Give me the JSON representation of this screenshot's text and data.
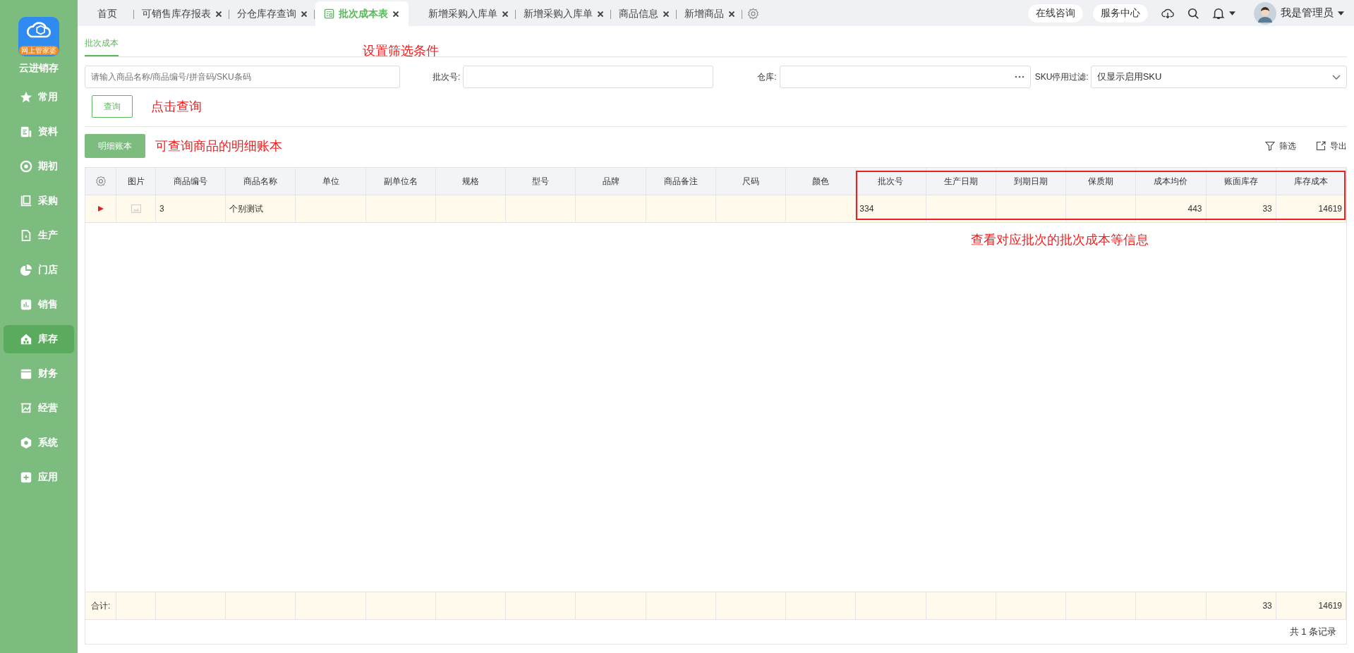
{
  "sidebar": {
    "logo_badge": "网上管家婆",
    "app_name": "云进销存",
    "items": [
      {
        "label": "常用",
        "selected": false
      },
      {
        "label": "资料",
        "selected": false
      },
      {
        "label": "期初",
        "selected": false
      },
      {
        "label": "采购",
        "selected": false
      },
      {
        "label": "生产",
        "selected": false
      },
      {
        "label": "门店",
        "selected": false
      },
      {
        "label": "销售",
        "selected": false
      },
      {
        "label": "库存",
        "selected": true
      },
      {
        "label": "财务",
        "selected": false
      },
      {
        "label": "经营",
        "selected": false
      },
      {
        "label": "系统",
        "selected": false
      },
      {
        "label": "应用",
        "selected": false
      }
    ]
  },
  "tabs": [
    {
      "label": "首页",
      "selected": false,
      "closable": false
    },
    {
      "label": "可销售库存报表",
      "selected": false,
      "closable": true
    },
    {
      "label": "分仓库存查询",
      "selected": false,
      "closable": true
    },
    {
      "label": "批次成本表",
      "selected": true,
      "closable": true
    },
    {
      "label": "新增采购入库单",
      "selected": false,
      "closable": true
    },
    {
      "label": "新增采购入库单",
      "selected": false,
      "closable": true
    },
    {
      "label": "商品信息",
      "selected": false,
      "closable": true
    },
    {
      "label": "新增商品",
      "selected": false,
      "closable": true
    }
  ],
  "header_buttons": [
    "在线咨询",
    "服务中心"
  ],
  "user": "我是管理员",
  "sub_tab": "批次成本",
  "filters": {
    "search_placeholder": "请输入商品名称/商品编号/拼音码/SKU条码",
    "batch_label": "批次号:",
    "warehouse_label": "仓库:",
    "sku_label": "SKU停用过滤:",
    "sku_value": "仅显示启用SKU"
  },
  "query_button": "查询",
  "detail_button": "明细账本",
  "toolbar": [
    "筛选",
    "导出"
  ],
  "annotations": {
    "filters": "设置筛选条件",
    "query": "点击查询",
    "detail": "可查询商品的明细账本",
    "table": "查看对应批次的批次成本等信息"
  },
  "table": {
    "columns": [
      {
        "label": "图片",
        "kind": "image"
      },
      {
        "label": "商品编号",
        "kind": "text",
        "values": [
          "3"
        ]
      },
      {
        "label": "商品名称",
        "kind": "text",
        "values": [
          "个别测试"
        ]
      },
      {
        "label": "单位",
        "kind": "text"
      },
      {
        "label": "副单位名",
        "kind": "text"
      },
      {
        "label": "规格",
        "kind": "text"
      },
      {
        "label": "型号",
        "kind": "text"
      },
      {
        "label": "品牌",
        "kind": "text"
      },
      {
        "label": "商品备注",
        "kind": "text"
      },
      {
        "label": "尺码",
        "kind": "text"
      },
      {
        "label": "颜色",
        "kind": "text"
      },
      {
        "label": "批次号",
        "kind": "text",
        "values": [
          "334"
        ]
      },
      {
        "label": "生产日期",
        "kind": "text"
      },
      {
        "label": "到期日期",
        "kind": "text"
      },
      {
        "label": "保质期",
        "kind": "text"
      },
      {
        "label": "成本均价",
        "kind": "number",
        "values": [
          "443"
        ]
      },
      {
        "label": "账面库存",
        "kind": "number",
        "values": [
          "33"
        ],
        "total": "33"
      },
      {
        "label": "库存成本",
        "kind": "number",
        "values": [
          "14619"
        ],
        "total": "14619"
      }
    ],
    "rows": [
      {
        "current": true
      }
    ],
    "total_label": "合计:",
    "record_count": "共 1 条记录"
  }
}
